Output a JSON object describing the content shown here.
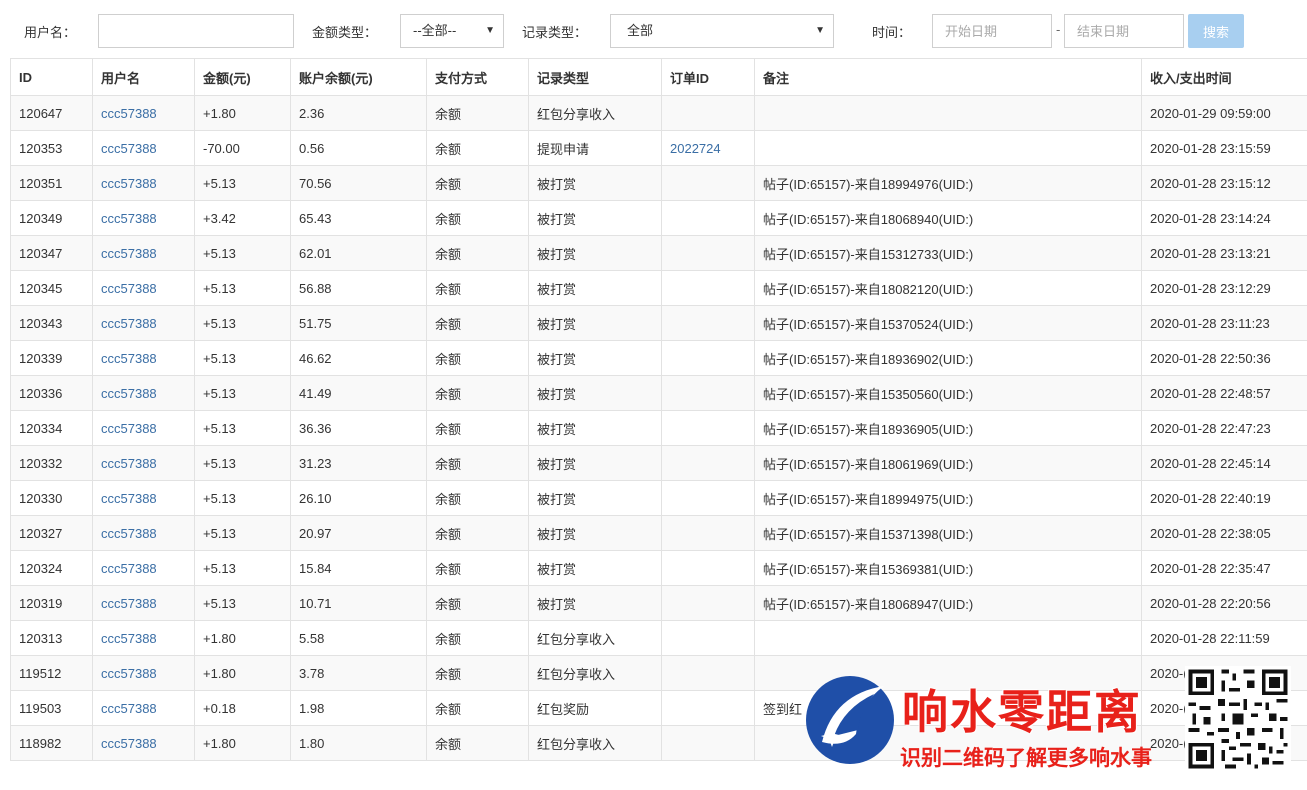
{
  "filters": {
    "username_label": "用户名：",
    "username_value": "",
    "amount_type_label": "金额类型：",
    "amount_type_selected": "--全部--",
    "record_type_label": "记录类型：",
    "record_type_selected": "全部",
    "time_label": "时间：",
    "start_placeholder": "开始日期",
    "range_separator": "-",
    "end_placeholder": "结束日期",
    "search_label": "搜索"
  },
  "table": {
    "headers": [
      "ID",
      "用户名",
      "金额(元)",
      "账户余额(元)",
      "支付方式",
      "记录类型",
      "订单ID",
      "备注",
      "收入/支出时间"
    ],
    "rows": [
      [
        "120647",
        "ccc57388",
        "+1.80",
        "2.36",
        "余额",
        "红包分享收入",
        "",
        "",
        "2020-01-29 09:59:00"
      ],
      [
        "120353",
        "ccc57388",
        "-70.00",
        "0.56",
        "余额",
        "提现申请",
        "2022724",
        "",
        "2020-01-28 23:15:59"
      ],
      [
        "120351",
        "ccc57388",
        "+5.13",
        "70.56",
        "余额",
        "被打赏",
        "",
        "帖子(ID:65157)-来自18994976(UID:)",
        "2020-01-28 23:15:12"
      ],
      [
        "120349",
        "ccc57388",
        "+3.42",
        "65.43",
        "余额",
        "被打赏",
        "",
        "帖子(ID:65157)-来自18068940(UID:)",
        "2020-01-28 23:14:24"
      ],
      [
        "120347",
        "ccc57388",
        "+5.13",
        "62.01",
        "余额",
        "被打赏",
        "",
        "帖子(ID:65157)-来自15312733(UID:)",
        "2020-01-28 23:13:21"
      ],
      [
        "120345",
        "ccc57388",
        "+5.13",
        "56.88",
        "余额",
        "被打赏",
        "",
        "帖子(ID:65157)-来自18082120(UID:)",
        "2020-01-28 23:12:29"
      ],
      [
        "120343",
        "ccc57388",
        "+5.13",
        "51.75",
        "余额",
        "被打赏",
        "",
        "帖子(ID:65157)-来自15370524(UID:)",
        "2020-01-28 23:11:23"
      ],
      [
        "120339",
        "ccc57388",
        "+5.13",
        "46.62",
        "余额",
        "被打赏",
        "",
        "帖子(ID:65157)-来自18936902(UID:)",
        "2020-01-28 22:50:36"
      ],
      [
        "120336",
        "ccc57388",
        "+5.13",
        "41.49",
        "余额",
        "被打赏",
        "",
        "帖子(ID:65157)-来自15350560(UID:)",
        "2020-01-28 22:48:57"
      ],
      [
        "120334",
        "ccc57388",
        "+5.13",
        "36.36",
        "余额",
        "被打赏",
        "",
        "帖子(ID:65157)-来自18936905(UID:)",
        "2020-01-28 22:47:23"
      ],
      [
        "120332",
        "ccc57388",
        "+5.13",
        "31.23",
        "余额",
        "被打赏",
        "",
        "帖子(ID:65157)-来自18061969(UID:)",
        "2020-01-28 22:45:14"
      ],
      [
        "120330",
        "ccc57388",
        "+5.13",
        "26.10",
        "余额",
        "被打赏",
        "",
        "帖子(ID:65157)-来自18994975(UID:)",
        "2020-01-28 22:40:19"
      ],
      [
        "120327",
        "ccc57388",
        "+5.13",
        "20.97",
        "余额",
        "被打赏",
        "",
        "帖子(ID:65157)-来自15371398(UID:)",
        "2020-01-28 22:38:05"
      ],
      [
        "120324",
        "ccc57388",
        "+5.13",
        "15.84",
        "余额",
        "被打赏",
        "",
        "帖子(ID:65157)-来自15369381(UID:)",
        "2020-01-28 22:35:47"
      ],
      [
        "120319",
        "ccc57388",
        "+5.13",
        "10.71",
        "余额",
        "被打赏",
        "",
        "帖子(ID:65157)-来自18068947(UID:)",
        "2020-01-28 22:20:56"
      ],
      [
        "120313",
        "ccc57388",
        "+1.80",
        "5.58",
        "余额",
        "红包分享收入",
        "",
        "",
        "2020-01-28 22:11:59"
      ],
      [
        "119512",
        "ccc57388",
        "+1.80",
        "3.78",
        "余额",
        "红包分享收入",
        "",
        "",
        "2020-("
      ],
      [
        "119503",
        "ccc57388",
        "+0.18",
        "1.98",
        "余额",
        "红包奖励",
        "",
        "签到红",
        "2020-("
      ],
      [
        "118982",
        "ccc57388",
        "+1.80",
        "1.80",
        "余额",
        "红包分享收入",
        "",
        "",
        "2020-("
      ]
    ]
  },
  "watermark": {
    "title": "响水零距离",
    "subtitle": "识别二维码了解更多响水事"
  },
  "colors": {
    "link": "#3a6ea5",
    "search_button": "#a8cff0",
    "watermark_red": "#e8211a",
    "logo_blue": "#1f4fa8"
  }
}
